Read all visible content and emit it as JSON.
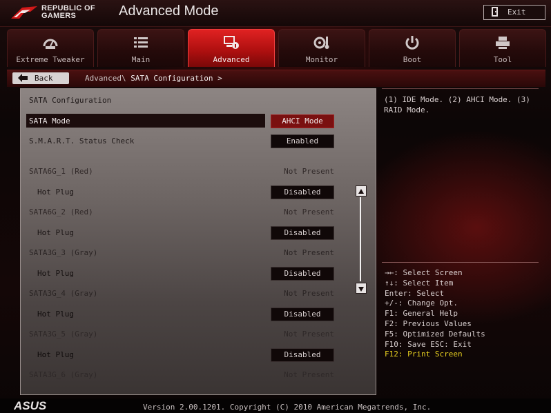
{
  "header": {
    "logo_line1": "REPUBLIC OF",
    "logo_line2": "GAMERS",
    "mode_title": "Advanced Mode",
    "exit_label": "Exit"
  },
  "tabs": [
    {
      "label": "Extreme Tweaker",
      "icon": "meter-icon"
    },
    {
      "label": "Main",
      "icon": "list-icon"
    },
    {
      "label": "Advanced",
      "icon": "advanced-icon",
      "active": true
    },
    {
      "label": "Monitor",
      "icon": "fan-temp-icon"
    },
    {
      "label": "Boot",
      "icon": "power-icon"
    },
    {
      "label": "Tool",
      "icon": "printer-icon"
    }
  ],
  "breadcrumb": {
    "back_label": "Back",
    "path": "Advanced\\ ",
    "current": "SATA Configuration >"
  },
  "panel": {
    "title": "SATA Configuration",
    "rows": [
      {
        "label": "SATA Mode",
        "value": "AHCI Mode"
      },
      {
        "label": "S.M.A.R.T. Status Check",
        "value": "Enabled"
      },
      {
        "label": "SATA6G_1 (Red)",
        "value": "Not Present"
      },
      {
        "label": "Hot Plug",
        "value": "Disabled"
      },
      {
        "label": "SATA6G_2 (Red)",
        "value": "Not Present"
      },
      {
        "label": "Hot Plug",
        "value": "Disabled"
      },
      {
        "label": "SATA3G_3 (Gray)",
        "value": "Not Present"
      },
      {
        "label": "Hot Plug",
        "value": "Disabled"
      },
      {
        "label": "SATA3G_4 (Gray)",
        "value": "Not Present"
      },
      {
        "label": "Hot Plug",
        "value": "Disabled"
      },
      {
        "label": "SATA3G_5 (Gray)",
        "value": "Not Present"
      },
      {
        "label": "Hot Plug",
        "value": "Disabled"
      },
      {
        "label": "SATA3G_6 (Gray)",
        "value": "Not Present"
      }
    ]
  },
  "help": {
    "description": "(1) IDE Mode. (2) AHCI Mode. (3) RAID Mode.",
    "keys": [
      "→←: Select Screen",
      "↑↓: Select Item",
      "Enter: Select",
      "+/-: Change Opt.",
      "F1: General Help",
      "F2: Previous Values",
      "F5: Optimized Defaults",
      "F10: Save  ESC: Exit",
      "F12: Print Screen"
    ]
  },
  "footer": {
    "brand": "ASUS",
    "version": "Version 2.00.1201. Copyright (C) 2010 American Megatrends, Inc."
  },
  "colors": {
    "accent_red": "#c81414",
    "highlight_yellow": "#e8d020",
    "panel_gray": "#7a7270"
  }
}
